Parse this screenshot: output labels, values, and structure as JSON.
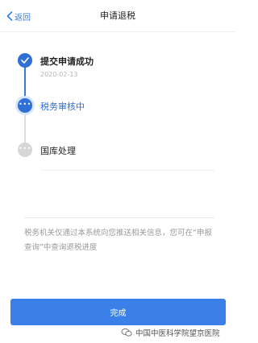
{
  "nav": {
    "back_label": "返回",
    "title": "申请退税"
  },
  "steps": [
    {
      "title": "提交申请成功",
      "date": "2020-02-13",
      "status": "done"
    },
    {
      "title": "税务审核中",
      "status": "active"
    },
    {
      "title": "国库处理",
      "status": "pending"
    }
  ],
  "notice": "税务机关仅通过本系统向您推送相关信息，您可在“申报查询”中查询退税进度",
  "button": {
    "label": "完成"
  },
  "watermark": {
    "text": "中国中医科学院望京医院"
  },
  "colors": {
    "accent": "#2f6fd6",
    "button": "#3a80e8",
    "pending": "#d6d6d6"
  }
}
